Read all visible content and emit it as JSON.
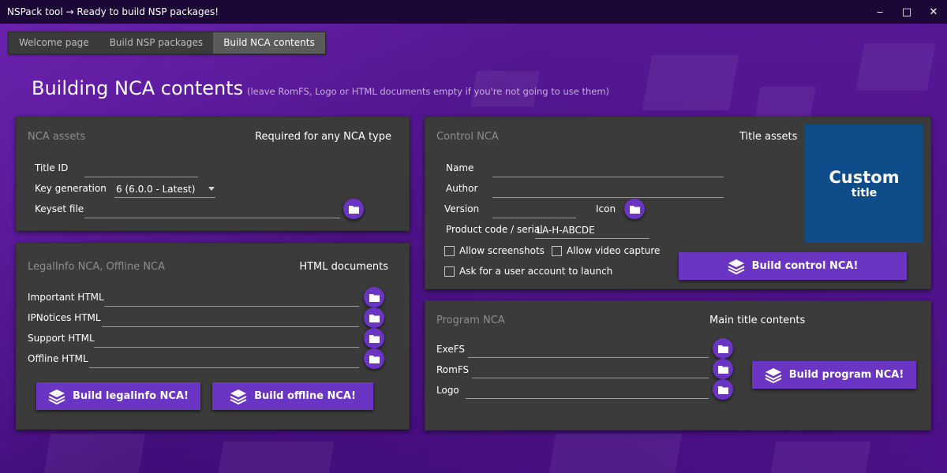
{
  "window": {
    "title": "NSPack tool → Ready to build NSP packages!",
    "minimize_glyph": "‒",
    "maximize_glyph": "□",
    "close_glyph": "✕"
  },
  "tabs": [
    {
      "label": "Welcome page",
      "active": false
    },
    {
      "label": "Build NSP packages",
      "active": false
    },
    {
      "label": "Build NCA contents",
      "active": true
    }
  ],
  "page": {
    "title": "Building NCA contents",
    "hint": "(leave RomFS, Logo or HTML documents empty if you're not going to use them)"
  },
  "nca_assets": {
    "title": "NCA assets",
    "subtitle": "Required for any NCA type",
    "title_id_label": "Title ID",
    "title_id_value": "",
    "keygen_label": "Key generation",
    "keygen_value": "6 (6.0.0 - Latest)",
    "keyset_label": "Keyset file",
    "keyset_value": ""
  },
  "legal": {
    "title": "LegalInfo NCA, Offline NCA",
    "subtitle": "HTML documents",
    "fields": [
      {
        "label": "Important HTML",
        "value": ""
      },
      {
        "label": "IPNotices HTML",
        "value": ""
      },
      {
        "label": "Support HTML",
        "value": ""
      },
      {
        "label": "Offline HTML",
        "value": ""
      }
    ],
    "build_legalinfo": "Build legalinfo NCA!",
    "build_offline": "Build offline NCA!"
  },
  "control": {
    "title": "Control NCA",
    "subtitle": "Title assets",
    "name_label": "Name",
    "name_value": "",
    "author_label": "Author",
    "author_value": "",
    "version_label": "Version",
    "version_value": "",
    "icon_label": "Icon",
    "product_label": "Product code / serial",
    "product_value": "LA-H-ABCDE",
    "allow_screenshots": "Allow screenshots",
    "allow_video": "Allow video capture",
    "ask_account": "Ask for a user account to launch",
    "build_button": "Build control NCA!",
    "preview_line1": "Custom",
    "preview_line2": "title",
    "preview_color": "#0f4d8a"
  },
  "program": {
    "title": "Program NCA",
    "subtitle": "Main title contents",
    "exefs_label": "ExeFS",
    "romfs_label": "RomFS",
    "logo_label": "Logo",
    "build_button": "Build program NCA!"
  },
  "colors": {
    "accent": "#6a35c2",
    "card": "#3b3b3b",
    "titlebar": "#1b0836"
  }
}
